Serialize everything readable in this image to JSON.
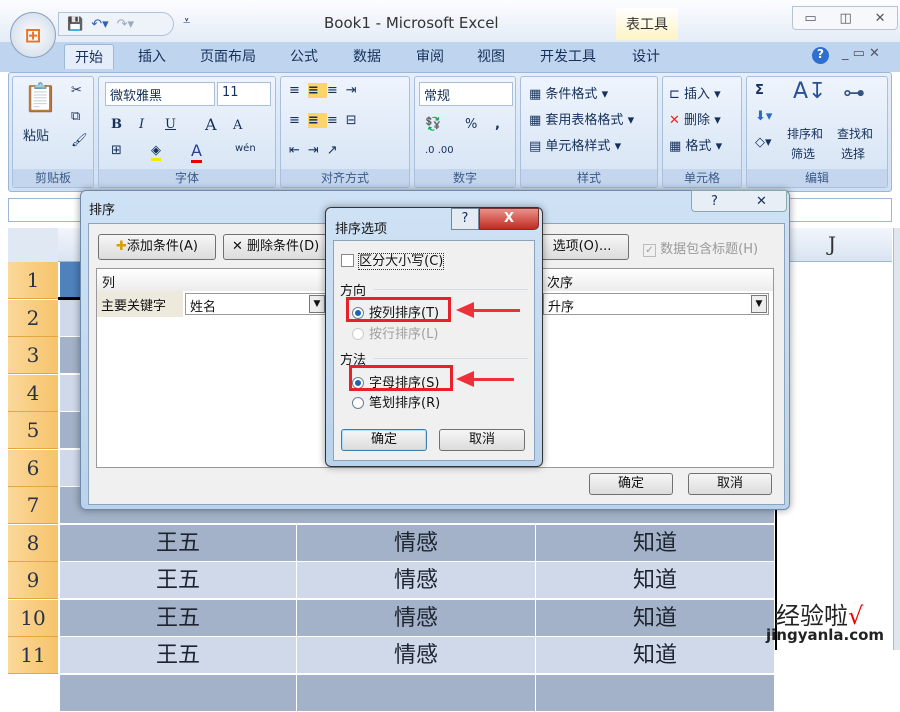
{
  "window": {
    "title": "Book1 - Microsoft Excel",
    "context_tab": "表工具"
  },
  "ribbon_tabs": [
    "开始",
    "插入",
    "页面布局",
    "公式",
    "数据",
    "审阅",
    "视图",
    "开发工具",
    "设计"
  ],
  "ribbon": {
    "clipboard": {
      "label": "剪贴板",
      "paste": "粘贴"
    },
    "font": {
      "label": "字体",
      "font_name": "微软雅黑",
      "font_size": "11",
      "bold": "B",
      "italic": "I",
      "underline": "U",
      "grow": "A",
      "shrink": "A",
      "phonetic": "wén"
    },
    "alignment": {
      "label": "对齐方式"
    },
    "number": {
      "label": "数字",
      "format": "常规",
      "percent": "%",
      "comma": ","
    },
    "styles": {
      "label": "样式",
      "conditional": "条件格式",
      "table": "套用表格格式",
      "cell": "单元格样式"
    },
    "cells": {
      "label": "单元格",
      "insert": "插入",
      "delete": "删除",
      "format": "格式"
    },
    "editing": {
      "label": "编辑",
      "sigma": "Σ",
      "sort_filter": "排序和",
      "sort_filter2": "筛选",
      "find": "查找和",
      "find2": "选择"
    }
  },
  "sheet": {
    "col_j": "J",
    "row_numbers": [
      "1",
      "2",
      "3",
      "4",
      "5",
      "6",
      "7",
      "8",
      "9",
      "10",
      "11"
    ],
    "rows": [
      [
        "王五",
        "情感",
        "知道"
      ],
      [
        "王五",
        "情感",
        "知道"
      ],
      [
        "王五",
        "情感",
        "知道"
      ],
      [
        "王五",
        "情感",
        "知道"
      ]
    ]
  },
  "sort_dialog": {
    "title": "排序",
    "add": "添加条件(A)",
    "delete": "删除条件(D)",
    "options": "选项(O)...",
    "header_check": "数据包含标题(H)",
    "header_checked": true,
    "col_header": "列",
    "order_header": "次序",
    "key_label": "主要关键字",
    "key_value": "姓名",
    "order_value": "升序",
    "ok": "确定",
    "cancel": "取消"
  },
  "options_dialog": {
    "title": "排序选项",
    "help": "?",
    "close": "X",
    "case": "区分大小写(C)",
    "case_checked": false,
    "direction": "方向",
    "by_col": "按列排序(T)",
    "by_row": "按行排序(L)",
    "method": "方法",
    "alpha": "字母排序(S)",
    "stroke": "笔划排序(R)",
    "selected_direction": "按列排序(T)",
    "selected_method": "字母排序(S)",
    "ok": "确定",
    "cancel": "取消"
  },
  "watermark": {
    "text": "经验啦",
    "url_text": "jingyanla.com",
    "check": "√"
  },
  "colors": {
    "highlight": "#e8202a",
    "row_dark": "#a3b2c8",
    "row_light": "#cfd9ea"
  }
}
